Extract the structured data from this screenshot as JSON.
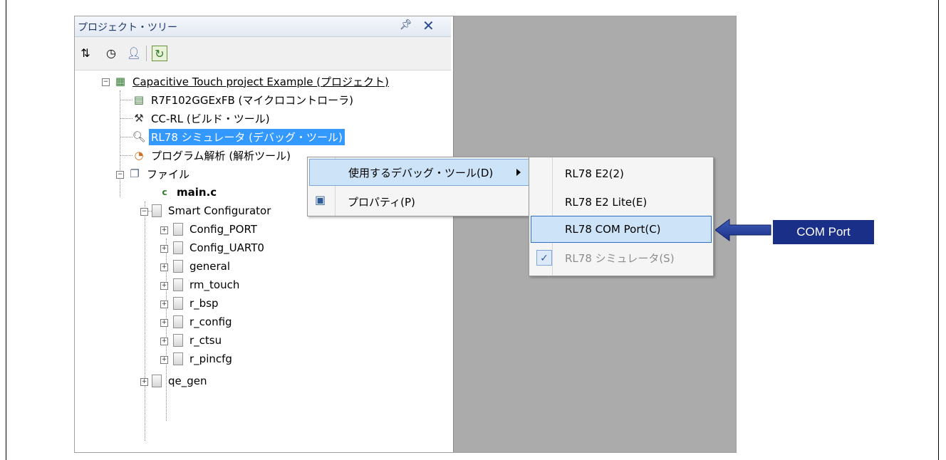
{
  "panel": {
    "title": "プロジェクト・ツリー",
    "pin_icon": "pin-icon",
    "close_icon": "close-icon"
  },
  "toolbar": {
    "icons": [
      "sort-icon",
      "clock-icon",
      "person-icon",
      "refresh-icon"
    ]
  },
  "tree": {
    "project": "Capacitive Touch project Example (プロジェクト)",
    "microcontroller": "R7F102GGExFB (マイクロコントローラ)",
    "build_tool": "CC-RL (ビルド・ツール)",
    "debug_tool": "RL78 シミュレータ (デバッグ・ツール)",
    "analysis": "プログラム解析 (解析ツール)",
    "files": "ファイル",
    "main_c": "main.c",
    "smart_configurator": "Smart Configurator",
    "sc_children": [
      "Config_PORT",
      "Config_UART0",
      "general",
      "rm_touch",
      "r_bsp",
      "r_config",
      "r_ctsu",
      "r_pincfg"
    ],
    "qe_gen": "qe_gen"
  },
  "context_menu": {
    "use_debug_tool": "使用するデバッグ・ツール(D)",
    "properties": "プロパティ(P)"
  },
  "submenu": {
    "items": [
      "RL78 E2(2)",
      "RL78 E2 Lite(E)",
      "RL78 COM Port(C)",
      "RL78 シミュレータ(S)"
    ]
  },
  "callout": {
    "label": "COM Port",
    "color": "#1a2f88"
  }
}
